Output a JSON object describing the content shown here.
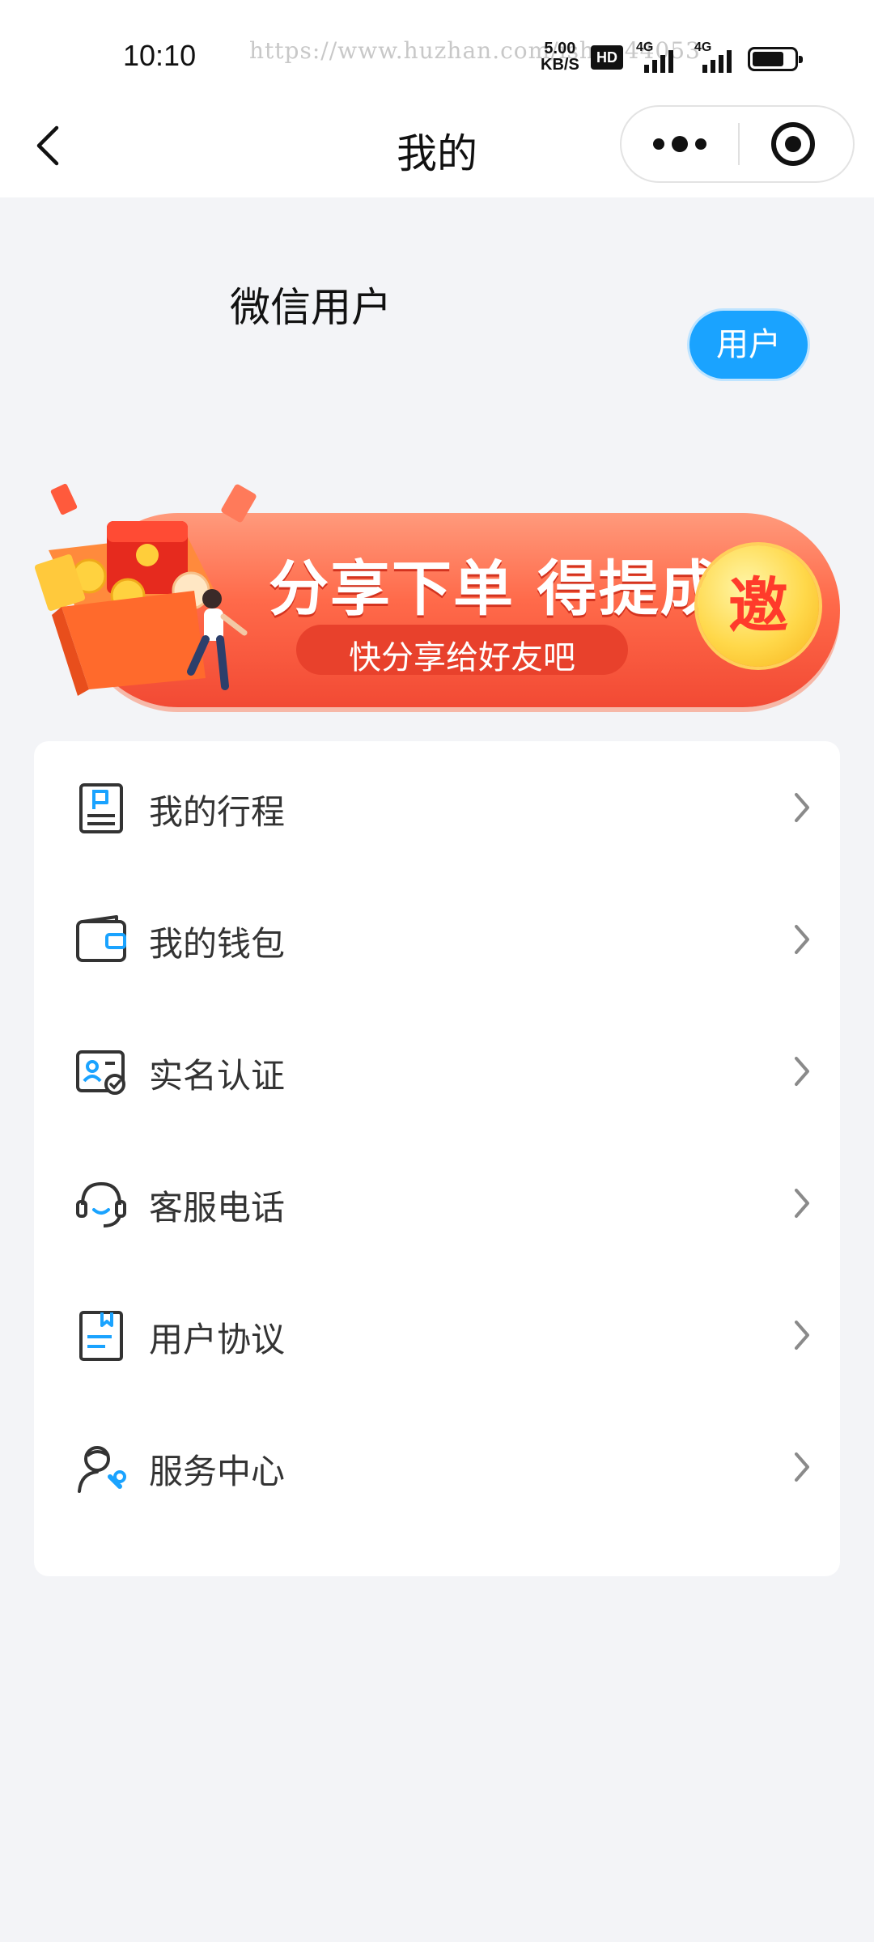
{
  "status_bar": {
    "time": "10:10",
    "watermark": "https://www.huzhan.com/ishop44053",
    "speed_value": "5.00",
    "speed_unit": "KB/S",
    "hd": "HD",
    "signal1": "4G",
    "signal2": "4G",
    "battery_level": 0.75
  },
  "nav": {
    "title": "我的",
    "back_icon": "chevron-left-icon",
    "more_icon": "more-dots-icon",
    "close_icon": "target-circle-icon"
  },
  "profile": {
    "name": "微信用户",
    "role": "用户"
  },
  "banner": {
    "title": "分享下单 得提成",
    "subtitle": "快分享给好友吧",
    "invite": "邀"
  },
  "menu": {
    "items": [
      {
        "label": "我的行程",
        "icon": "trip-flag-icon"
      },
      {
        "label": "我的钱包",
        "icon": "wallet-icon"
      },
      {
        "label": "实名认证",
        "icon": "id-verify-icon"
      },
      {
        "label": "客服电话",
        "icon": "headset-icon"
      },
      {
        "label": "用户协议",
        "icon": "agreement-doc-icon"
      },
      {
        "label": "服务中心",
        "icon": "service-person-icon"
      }
    ]
  },
  "colors": {
    "accent": "#1aa3ff",
    "banner_red": "#f24a34",
    "background": "#f3f4f7"
  }
}
